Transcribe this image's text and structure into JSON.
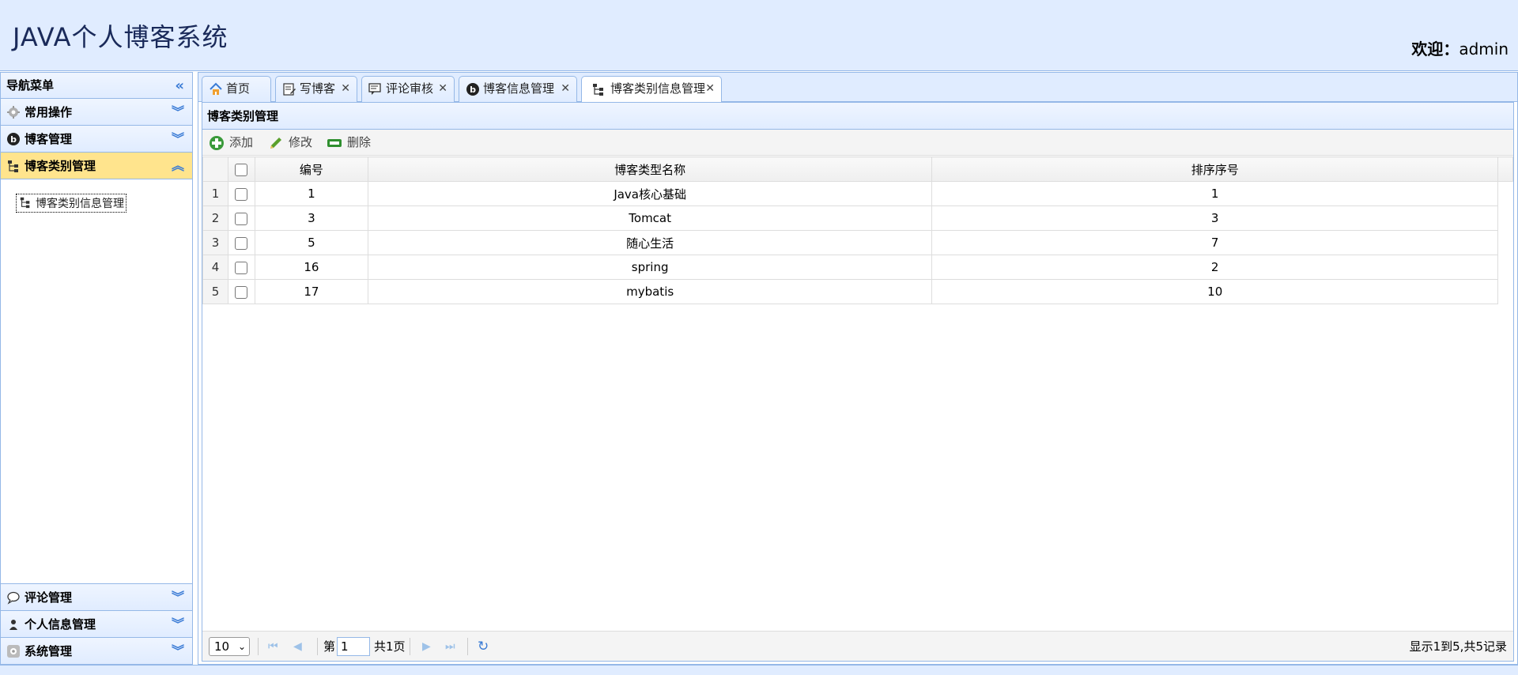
{
  "header": {
    "logo": "JAVA个人博客系统",
    "welcome_label": "欢迎：",
    "username": "admin"
  },
  "sidebar": {
    "title": "导航菜单",
    "collapse_icon": "double-chevron-left-icon",
    "sections": [
      {
        "label": "常用操作",
        "icon": "gear-icon",
        "state": "collapsed"
      },
      {
        "label": "博客管理",
        "icon": "blog-icon",
        "state": "collapsed"
      },
      {
        "label": "博客类别管理",
        "icon": "category-tree-icon",
        "state": "expanded"
      }
    ],
    "active_section_items": [
      {
        "label": "博客类别信息管理",
        "icon": "category-tree-icon"
      }
    ],
    "bottom_sections": [
      {
        "label": "评论管理",
        "icon": "comment-icon"
      },
      {
        "label": "个人信息管理",
        "icon": "person-icon"
      },
      {
        "label": "系统管理",
        "icon": "system-icon"
      }
    ]
  },
  "tabs": [
    {
      "label": "首页",
      "icon": "home-icon",
      "closable": false
    },
    {
      "label": "写博客",
      "icon": "edit-note-icon",
      "closable": true
    },
    {
      "label": "评论审核",
      "icon": "review-icon",
      "closable": true
    },
    {
      "label": "博客信息管理",
      "icon": "blog-icon",
      "closable": true
    },
    {
      "label": "博客类别信息管理",
      "icon": "category-tree-icon",
      "closable": true,
      "active": true
    }
  ],
  "panel": {
    "title": "博客类别管理",
    "toolbar": {
      "add_label": "添加",
      "edit_label": "修改",
      "delete_label": "删除"
    },
    "grid": {
      "columns": [
        "编号",
        "博客类型名称",
        "排序序号"
      ],
      "rows": [
        {
          "rownum": "1",
          "id": "1",
          "name": "Java核心基础",
          "order": "1"
        },
        {
          "rownum": "2",
          "id": "3",
          "name": "Tomcat",
          "order": "3"
        },
        {
          "rownum": "3",
          "id": "5",
          "name": "随心生活",
          "order": "7"
        },
        {
          "rownum": "4",
          "id": "16",
          "name": "spring",
          "order": "2"
        },
        {
          "rownum": "5",
          "id": "17",
          "name": "mybatis",
          "order": "10"
        }
      ]
    },
    "pager": {
      "page_size": "10",
      "page_prefix": "第",
      "page_value": "1",
      "page_suffix": "共1页",
      "summary": "显示1到5,共5记录"
    }
  },
  "colors": {
    "header_bg": "#e0ecff",
    "border": "#95b8e7",
    "active_section": "#ffe48d"
  }
}
